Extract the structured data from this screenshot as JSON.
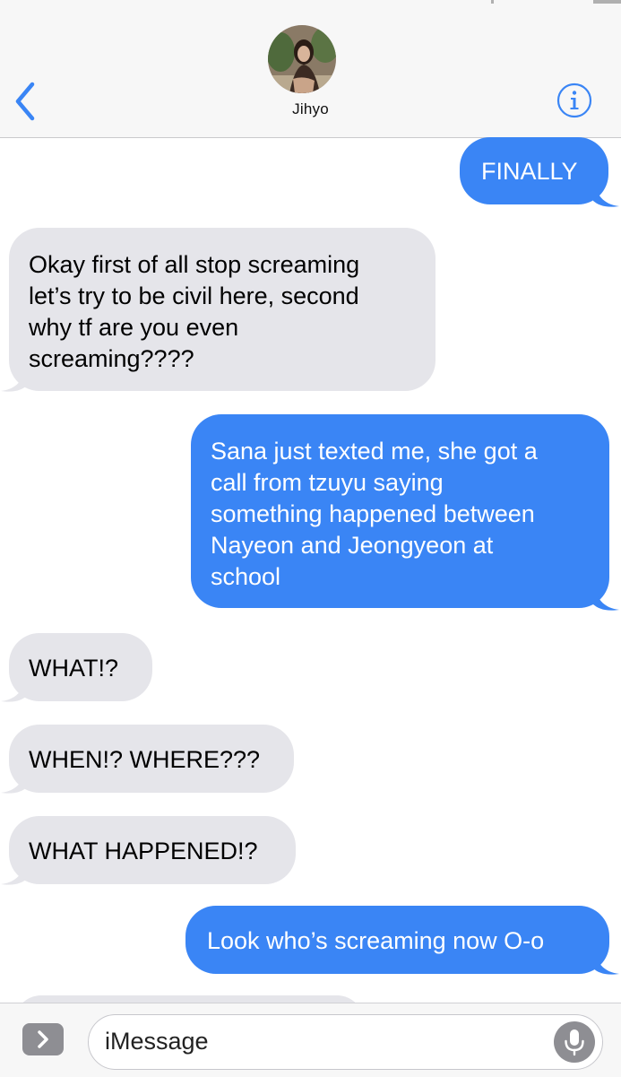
{
  "header": {
    "contact_name": "Jihyo",
    "back_icon": "chevron-left-icon",
    "info_icon": "info-circle-icon",
    "accent_color": "#3a85f5"
  },
  "messages": [
    {
      "direction": "outgoing",
      "text": "FINALLY"
    },
    {
      "direction": "incoming",
      "lines": [
        "Okay first of all stop screaming",
        "let’s try to be civil here, second",
        "why tf are you even",
        "screaming????"
      ]
    },
    {
      "direction": "outgoing",
      "lines": [
        "Sana just texted me, she got a",
        "call from tzuyu saying",
        "something happened between",
        "Nayeon and Jeongyeon at",
        "school"
      ]
    },
    {
      "direction": "incoming",
      "text": "WHAT!?"
    },
    {
      "direction": "incoming",
      "text": "WHEN!? WHERE???"
    },
    {
      "direction": "incoming",
      "text": "WHAT HAPPENED!?"
    },
    {
      "direction": "outgoing",
      "text": "Look who’s screaming now O-o"
    }
  ],
  "composer": {
    "placeholder": "iMessage",
    "expand_icon": "chevron-right-icon",
    "mic_icon": "microphone-icon"
  },
  "colors": {
    "incoming_bubble": "#e5e5ea",
    "outgoing_bubble": "#3a85f5"
  }
}
